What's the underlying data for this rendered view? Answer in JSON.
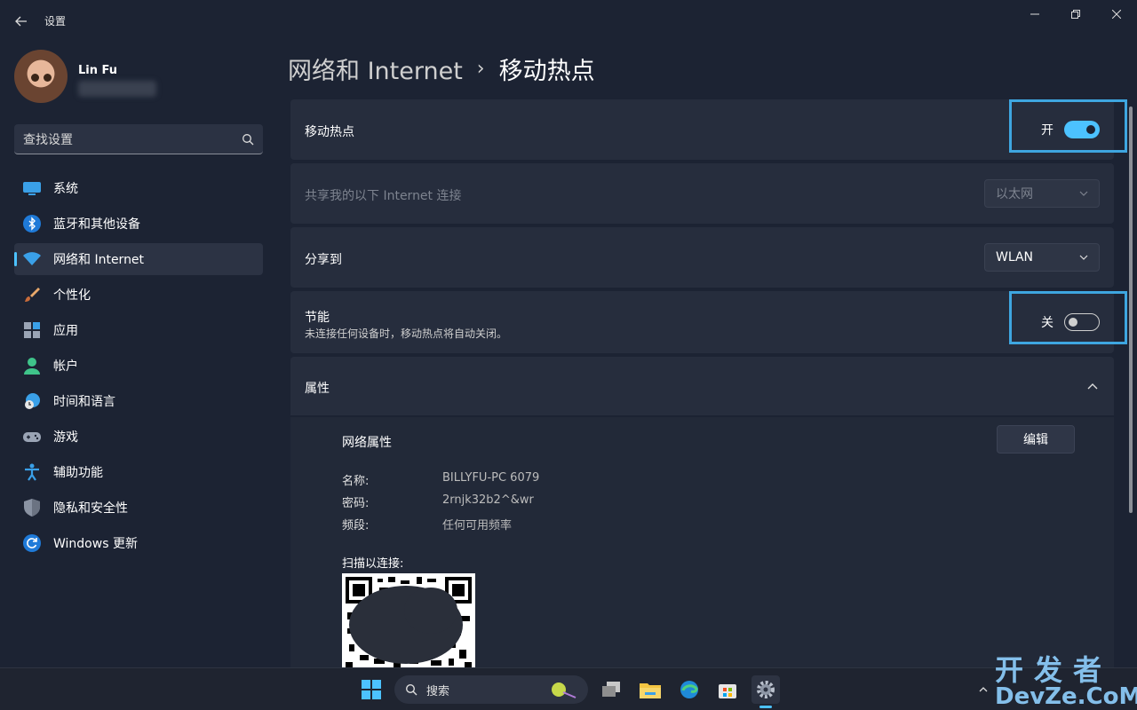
{
  "window": {
    "title": "设置"
  },
  "user": {
    "name": "Lin Fu"
  },
  "search": {
    "placeholder": "查找设置"
  },
  "sidebar": {
    "items": [
      {
        "label": "系统",
        "icon": "monitor-icon"
      },
      {
        "label": "蓝牙和其他设备",
        "icon": "bluetooth-icon"
      },
      {
        "label": "网络和 Internet",
        "icon": "wifi-icon",
        "selected": true
      },
      {
        "label": "个性化",
        "icon": "paintbrush-icon"
      },
      {
        "label": "应用",
        "icon": "apps-icon"
      },
      {
        "label": "帐户",
        "icon": "person-icon"
      },
      {
        "label": "时间和语言",
        "icon": "clock-globe-icon"
      },
      {
        "label": "游戏",
        "icon": "gamepad-icon"
      },
      {
        "label": "辅助功能",
        "icon": "accessibility-icon"
      },
      {
        "label": "隐私和安全性",
        "icon": "shield-icon"
      },
      {
        "label": "Windows 更新",
        "icon": "refresh-icon"
      }
    ]
  },
  "breadcrumb": {
    "parent": "网络和 Internet",
    "separator": "›",
    "current": "移动热点"
  },
  "hotspot": {
    "label": "移动热点",
    "state_text": "开",
    "on": true
  },
  "share_connection": {
    "label": "共享我的以下 Internet 连接",
    "value": "以太网",
    "disabled": true
  },
  "share_over": {
    "label": "分享到",
    "value": "WLAN"
  },
  "power_saving": {
    "label": "节能",
    "description": "未连接任何设备时，移动热点将自动关闭。",
    "state_text": "关",
    "on": false
  },
  "properties": {
    "header": "属性",
    "section_title": "网络属性",
    "edit_label": "编辑",
    "rows": [
      {
        "key": "名称:",
        "value": "BILLYFU-PC 6079"
      },
      {
        "key": "密码:",
        "value": "2rnjk32b2^&wr"
      },
      {
        "key": "频段:",
        "value": "任何可用频率"
      }
    ],
    "scan_label": "扫描以连接:"
  },
  "taskbar": {
    "search_label": "搜索"
  },
  "watermark": {
    "top": "开发者",
    "bottom": "DevZe.CoM"
  },
  "colors": {
    "accent": "#4cc2ff",
    "highlight": "#3ea6e0",
    "background": "#1c2333",
    "card": "#262d3d"
  }
}
